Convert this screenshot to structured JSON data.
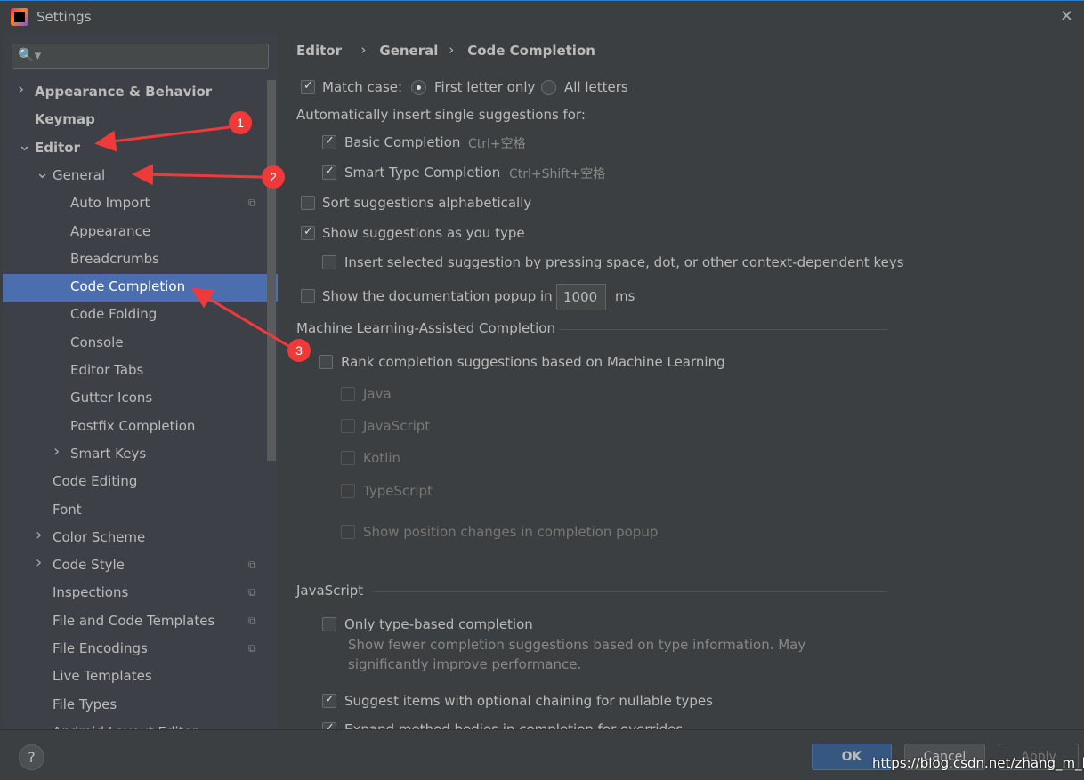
{
  "window": {
    "title": "Settings",
    "close": "✕",
    "logo": "intellij-logo"
  },
  "search": {
    "placeholder": "",
    "icon": "🔍▾"
  },
  "sidebar": {
    "items": [
      {
        "label": "Appearance & Behavior",
        "bold": true,
        "arrow": "›",
        "indent": 0
      },
      {
        "label": "Keymap",
        "bold": true,
        "indent": 0
      },
      {
        "label": "Editor",
        "bold": true,
        "arrow": "⌄",
        "indent": 0
      },
      {
        "label": "General",
        "arrow": "⌄",
        "indent": 1
      },
      {
        "label": "Auto Import",
        "indent": 2,
        "copy": true
      },
      {
        "label": "Appearance",
        "indent": 2
      },
      {
        "label": "Breadcrumbs",
        "indent": 2
      },
      {
        "label": "Code Completion",
        "indent": 2,
        "selected": true
      },
      {
        "label": "Code Folding",
        "indent": 2
      },
      {
        "label": "Console",
        "indent": 2
      },
      {
        "label": "Editor Tabs",
        "indent": 2
      },
      {
        "label": "Gutter Icons",
        "indent": 2
      },
      {
        "label": "Postfix Completion",
        "indent": 2
      },
      {
        "label": "Smart Keys",
        "arrow": "›",
        "indent": 2
      },
      {
        "label": "Code Editing",
        "indent": 1
      },
      {
        "label": "Font",
        "indent": 1
      },
      {
        "label": "Color Scheme",
        "arrow": "›",
        "indent": 1
      },
      {
        "label": "Code Style",
        "arrow": "›",
        "indent": 1,
        "copy": true
      },
      {
        "label": "Inspections",
        "indent": 1,
        "copy": true
      },
      {
        "label": "File and Code Templates",
        "indent": 1,
        "copy": true
      },
      {
        "label": "File Encodings",
        "indent": 1,
        "copy": true
      },
      {
        "label": "Live Templates",
        "indent": 1
      },
      {
        "label": "File Types",
        "indent": 1
      },
      {
        "label": "Android Layout Editor",
        "indent": 1
      }
    ]
  },
  "breadcrumb": [
    "Editor",
    "General",
    "Code Completion"
  ],
  "breadcrumb_sep": "›",
  "main": {
    "match_case": "Match case:",
    "first_letter": "First letter only",
    "all_letters": "All letters",
    "auto_insert": "Automatically insert single suggestions for:",
    "basic": "Basic Completion",
    "basic_key": "Ctrl+空格",
    "smart": "Smart Type Completion",
    "smart_key": "Ctrl+Shift+空格",
    "sort": "Sort suggestions alphabetically",
    "show_as_type": "Show suggestions as you type",
    "insert_selected": "Insert selected suggestion by pressing space, dot, or other context-dependent keys",
    "doc_popup": "Show the documentation popup in",
    "doc_ms_value": "1000",
    "ms": "ms",
    "ml_section": "Machine Learning-Assisted Completion",
    "rank": "Rank completion suggestions based on Machine Learning",
    "java": "Java",
    "javascript": "JavaScript",
    "kotlin": "Kotlin",
    "typescript": "TypeScript",
    "show_position": "Show position changes in completion popup",
    "js_section": "JavaScript",
    "only_type": "Only type-based completion",
    "only_type_desc1": "Show fewer completion suggestions based on type information. May",
    "only_type_desc2": "significantly improve performance.",
    "optional_chaining": "Suggest items with optional chaining for nullable types",
    "expand_method": "Expand method bodies in completion for overrides"
  },
  "footer": {
    "help": "?",
    "ok": "OK",
    "cancel": "Cancel",
    "apply": "Apply"
  },
  "annotations": [
    "1",
    "2",
    "3"
  ],
  "watermark": "https://blog.csdn.net/zhang_m_h",
  "colors": {
    "selection": "#4b6eaf",
    "annotation": "#f03a3a",
    "ok_button": "#365880"
  }
}
